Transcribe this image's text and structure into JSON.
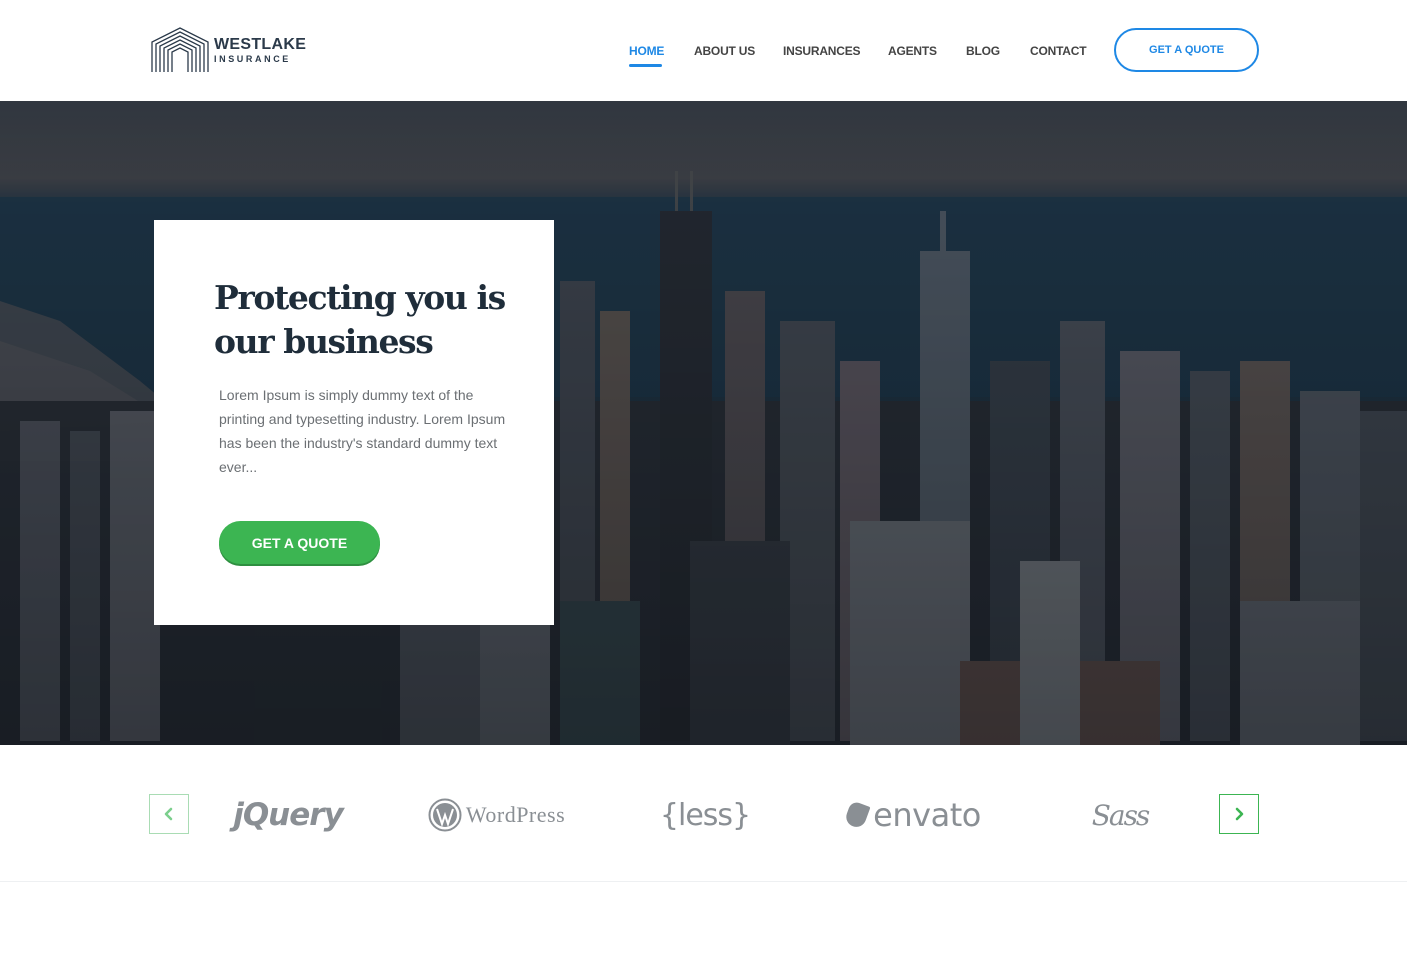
{
  "brand": {
    "name": "WESTLAKE",
    "tagline": "INSURANCE"
  },
  "nav": {
    "items": [
      {
        "label": "HOME",
        "active": true
      },
      {
        "label": "ABOUT US",
        "active": false
      },
      {
        "label": "INSURANCES",
        "active": false
      },
      {
        "label": "AGENTS",
        "active": false
      },
      {
        "label": "BLOG",
        "active": false
      },
      {
        "label": "CONTACT",
        "active": false
      }
    ],
    "cta_label": "GET A QUOTE"
  },
  "hero": {
    "title": "Protecting you is our business",
    "body": "Lorem Ipsum is simply dummy text of the printing and typesetting industry. Lorem Ipsum has been the industry's standard dummy text ever...",
    "button_label": "GET A QUOTE"
  },
  "partners": {
    "logos": [
      {
        "name": "jquery-logo",
        "text": "jQuery"
      },
      {
        "name": "wordpress-logo",
        "text": "WordPress"
      },
      {
        "name": "less-logo",
        "text": "{less}"
      },
      {
        "name": "envato-logo",
        "text": "envato"
      },
      {
        "name": "sass-logo",
        "text": "Sass"
      }
    ],
    "prev_icon": "chevron-left-icon",
    "next_icon": "chevron-right-icon"
  },
  "colors": {
    "accent_blue": "#1e88e5",
    "accent_green": "#3cb552",
    "heading": "#1f2d3a",
    "nav_text": "#444444"
  }
}
